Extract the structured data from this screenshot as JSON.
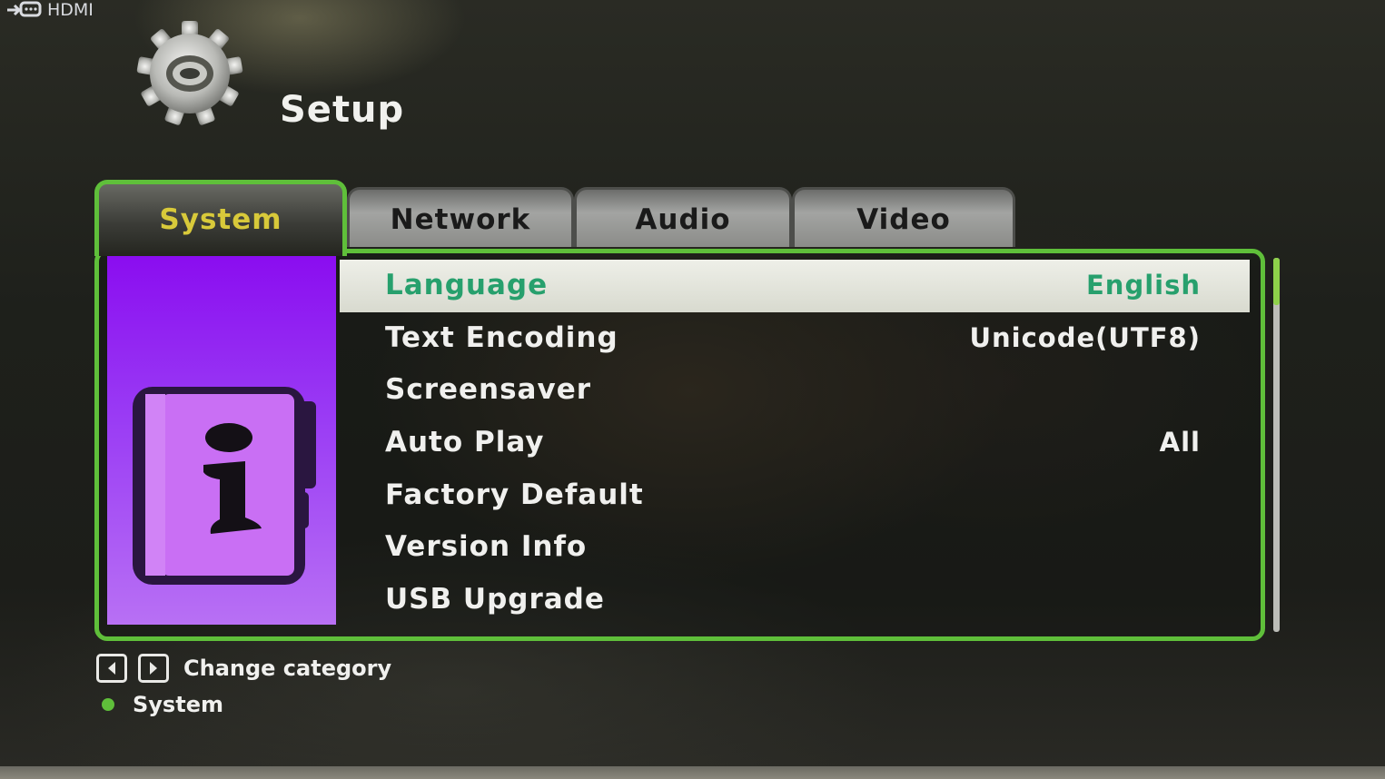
{
  "source": {
    "label": "HDMI",
    "icon": "hdmi-input-icon"
  },
  "header": {
    "title": "Setup",
    "icon": "gear-icon"
  },
  "tabs": [
    {
      "label": "System",
      "active": true
    },
    {
      "label": "Network",
      "active": false
    },
    {
      "label": "Audio",
      "active": false
    },
    {
      "label": "Video",
      "active": false
    }
  ],
  "side_panel": {
    "icon": "info-book-icon",
    "color": "#9a3cf4"
  },
  "menu": [
    {
      "label": "Language",
      "value": "English",
      "selected": true
    },
    {
      "label": "Text Encoding",
      "value": "Unicode(UTF8)"
    },
    {
      "label": "Screensaver",
      "value": ""
    },
    {
      "label": "Auto Play",
      "value": "All"
    },
    {
      "label": "Factory Default",
      "value": ""
    },
    {
      "label": "Version Info",
      "value": ""
    },
    {
      "label": "USB Upgrade",
      "value": ""
    }
  ],
  "footer": {
    "hint": "Change category",
    "hint_icons": [
      "left-arrow-key-icon",
      "right-arrow-key-icon"
    ],
    "breadcrumb": "System"
  },
  "colors": {
    "accent_green": "#5fbf3a",
    "selected_text": "#27a06d",
    "active_tab_text": "#d8c93a"
  }
}
